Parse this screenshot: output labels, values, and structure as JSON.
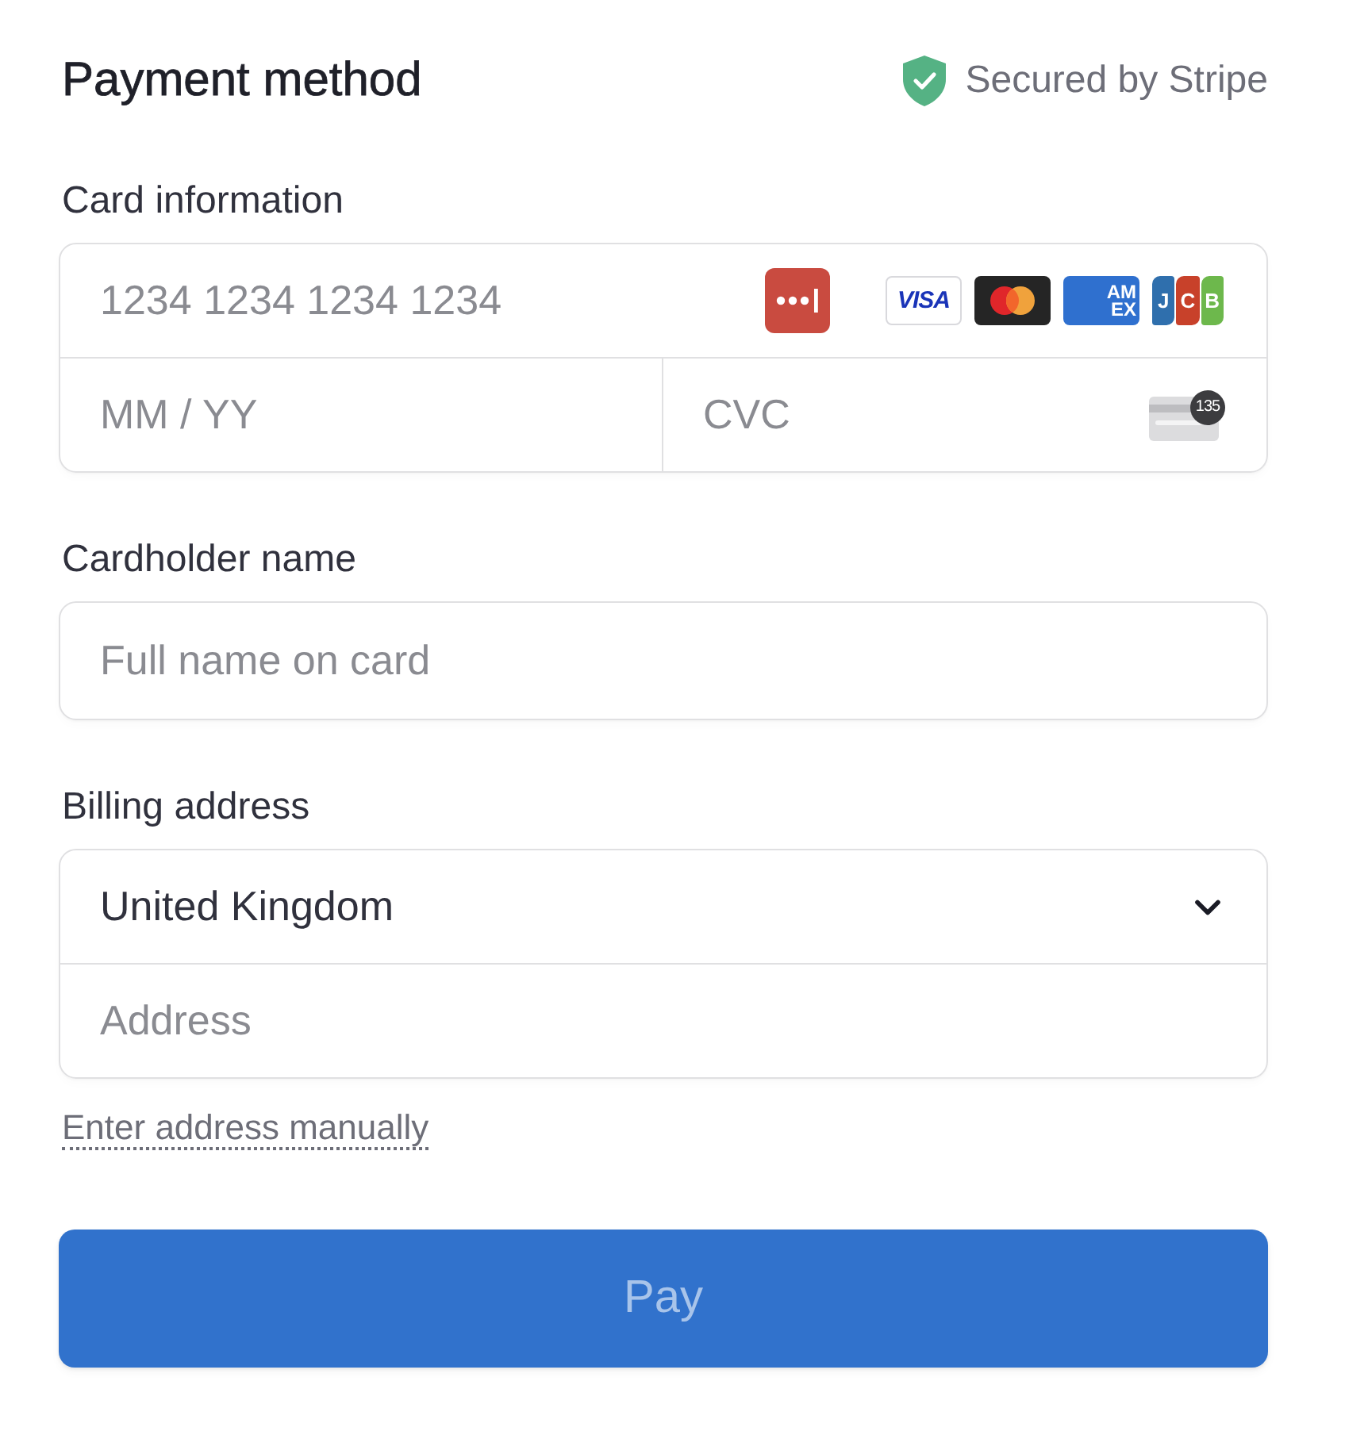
{
  "header": {
    "title": "Payment method",
    "badge": "Secured by Stripe"
  },
  "card_information": {
    "label": "Card information",
    "number_placeholder": "1234 1234 1234 1234",
    "brands": [
      {
        "kind": "visa",
        "text": "VISA"
      },
      {
        "kind": "mastercard"
      },
      {
        "kind": "amex",
        "lines": [
          "AM",
          "EX"
        ]
      },
      {
        "kind": "jcb",
        "letters": [
          "J",
          "C",
          "B"
        ]
      }
    ],
    "expiry_placeholder": "MM / YY",
    "cvc_placeholder": "CVC",
    "cvc_hint": "135"
  },
  "cardholder": {
    "label": "Cardholder name",
    "placeholder": "Full name on card"
  },
  "billing": {
    "label": "Billing address",
    "country_select": {
      "value": "United Kingdom"
    },
    "address_placeholder": "Address",
    "manual_link": "Enter address manually"
  },
  "pay_button": {
    "label": "Pay",
    "disabled": true
  }
}
